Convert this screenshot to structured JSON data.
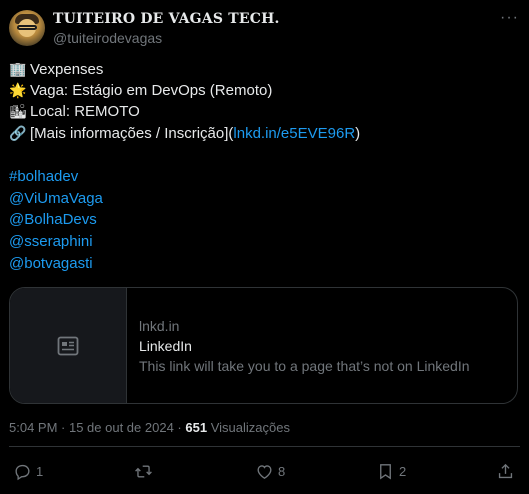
{
  "post": {
    "author_name": "TUITEIRO DE VAGAS TECH.",
    "author_handle": "@tuiteirodevagas",
    "more_label": "···",
    "lines": [
      {
        "icon": "🏢",
        "text": "Vexpenses"
      },
      {
        "icon": "🌟",
        "text": "Vaga: Estágio em DevOps (Remoto)"
      },
      {
        "icon": "🏙",
        "text": "Local: REMOTO"
      },
      {
        "icon": "🔗",
        "text_before": "[Mais informações / Inscrição](",
        "link": "lnkd.in/e5EVE96R",
        "text_after": ")"
      }
    ],
    "hashtags": [
      "#bolhadev",
      "@ViUmaVaga",
      "@BolhaDevs",
      "@sseraphini",
      "@botvagasti"
    ],
    "card": {
      "domain": "lnkd.in",
      "title": "LinkedIn",
      "description": "This link will take you to a page that’s not on LinkedIn"
    },
    "meta": {
      "time": "5:04 PM",
      "separator": " · ",
      "date": "15 de out de 2024",
      "views_count": "651",
      "views_label": "Visualizações"
    },
    "actions": {
      "replies": "1",
      "reposts": "",
      "likes": "8",
      "bookmarks": "2"
    }
  }
}
